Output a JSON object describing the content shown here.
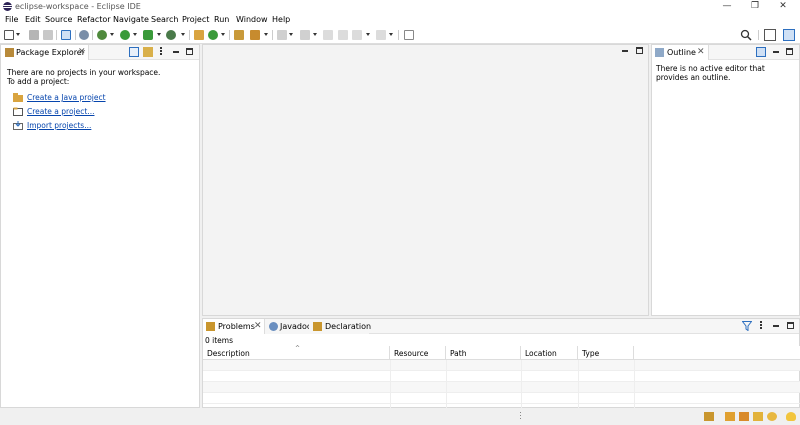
{
  "window": {
    "title": "eclipse-workspace - Eclipse IDE",
    "minimize_glyph": "—",
    "restore_glyph": "❐",
    "close_glyph": "✕"
  },
  "menu": [
    "File",
    "Edit",
    "Source",
    "Refactor",
    "Navigate",
    "Search",
    "Project",
    "Run",
    "Window",
    "Help"
  ],
  "package_explorer": {
    "tab_label": "Package Explorer",
    "empty_line1": "There are no projects in your workspace.",
    "empty_line2": "To add a project:",
    "links": [
      "Create a Java project",
      "Create a project...",
      "Import projects..."
    ]
  },
  "outline": {
    "tab_label": "Outline",
    "message": "There is no active editor that provides an outline."
  },
  "problems": {
    "tabs": [
      "Problems",
      "Javadoc",
      "Declaration"
    ],
    "items_count": "0 items",
    "columns": [
      "Description",
      "Resource",
      "Path",
      "Location",
      "Type"
    ]
  },
  "close_glyph": "✕",
  "colors": {
    "accent_blue": "#2d6fbf",
    "link": "#0645ad",
    "run_green": "#3a9a3a",
    "eclipse_purple": "#2c2255"
  }
}
